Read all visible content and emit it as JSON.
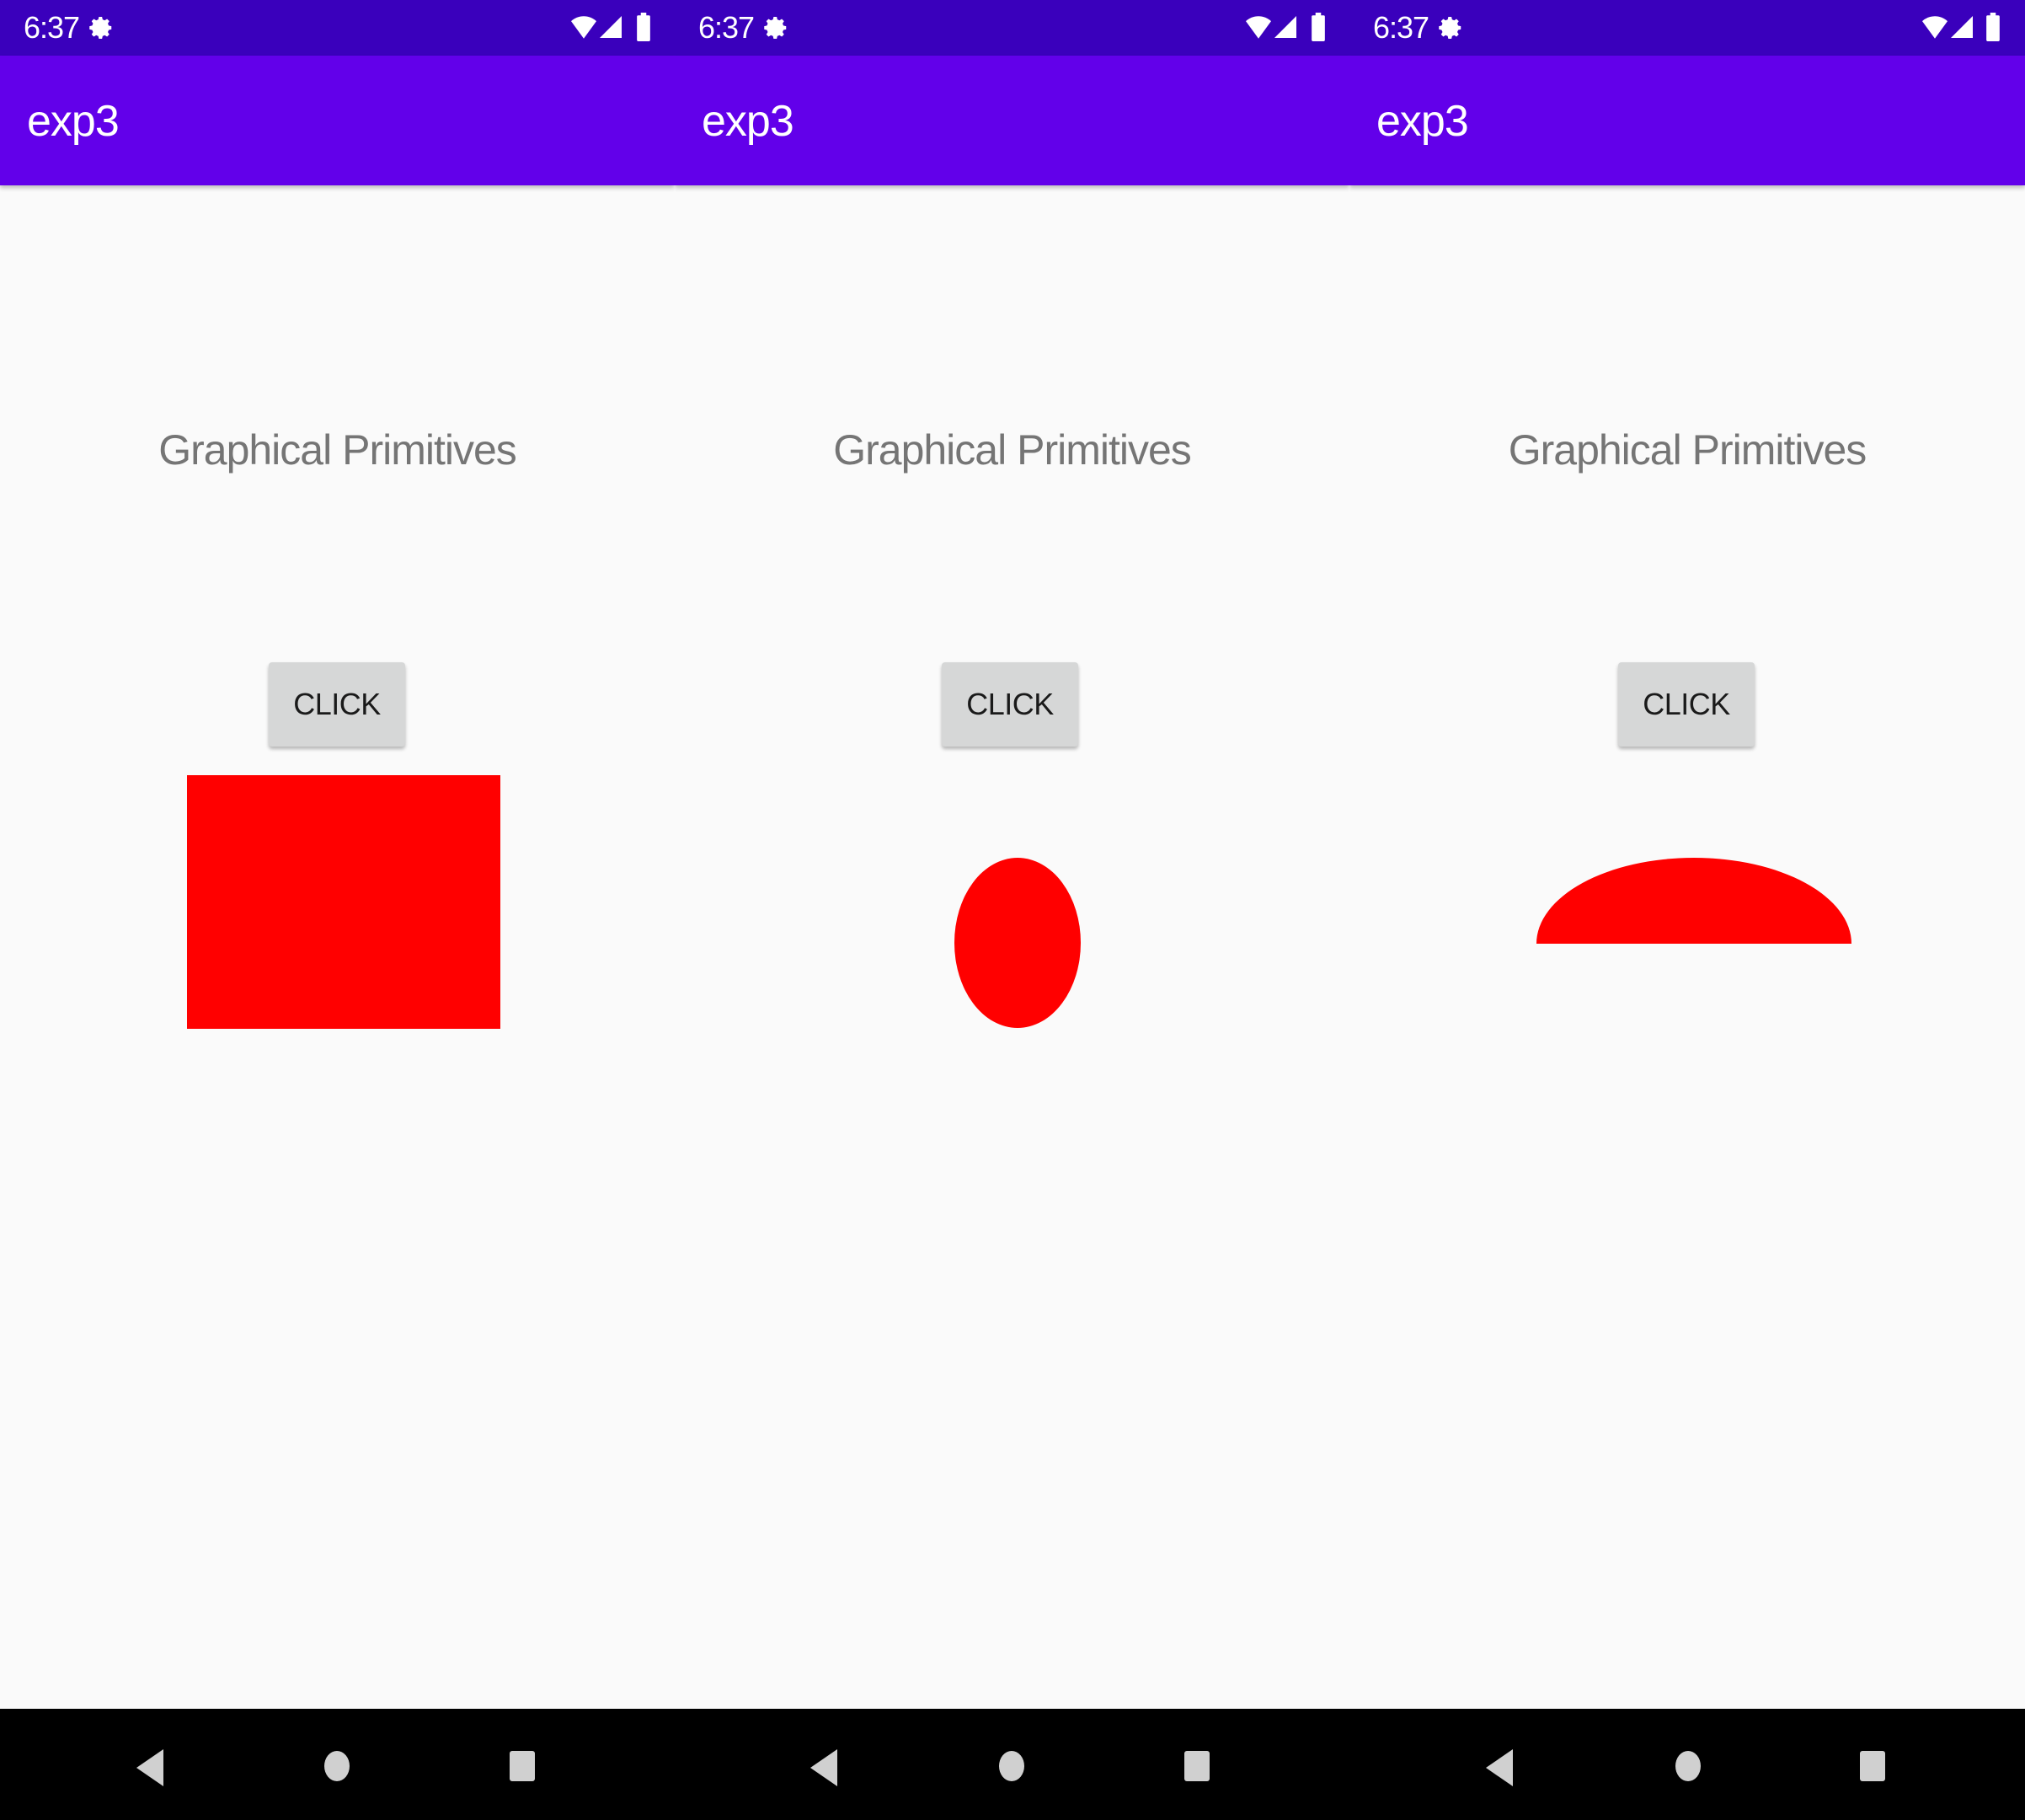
{
  "colors": {
    "status_bar": "#3a00bc",
    "app_bar": "#6200ea",
    "background": "#fafafa",
    "shape_fill": "#ff0000",
    "button_bg": "#d6d7d7",
    "heading_text": "#757575",
    "nav_bar": "#000000"
  },
  "screens": [
    {
      "status": {
        "time": "6:37",
        "icons": [
          "gear-icon",
          "wifi-icon",
          "signal-icon",
          "battery-icon"
        ]
      },
      "app_bar": {
        "title": "exp3"
      },
      "heading": "Graphical Primitives",
      "button": {
        "label": "CLICK"
      },
      "drawn_shape": "rectangle",
      "nav": [
        "back-icon",
        "home-icon",
        "recents-icon"
      ]
    },
    {
      "status": {
        "time": "6:37",
        "icons": [
          "gear-icon",
          "wifi-icon",
          "signal-icon",
          "battery-icon"
        ]
      },
      "app_bar": {
        "title": "exp3"
      },
      "heading": "Graphical Primitives",
      "button": {
        "label": "CLICK"
      },
      "drawn_shape": "ellipse",
      "nav": [
        "back-icon",
        "home-icon",
        "recents-icon"
      ]
    },
    {
      "status": {
        "time": "6:37",
        "icons": [
          "gear-icon",
          "wifi-icon",
          "signal-icon",
          "battery-icon"
        ]
      },
      "app_bar": {
        "title": "exp3"
      },
      "heading": "Graphical Primitives",
      "button": {
        "label": "CLICK"
      },
      "drawn_shape": "half-ellipse",
      "nav": [
        "back-icon",
        "home-icon",
        "recents-icon"
      ]
    }
  ]
}
